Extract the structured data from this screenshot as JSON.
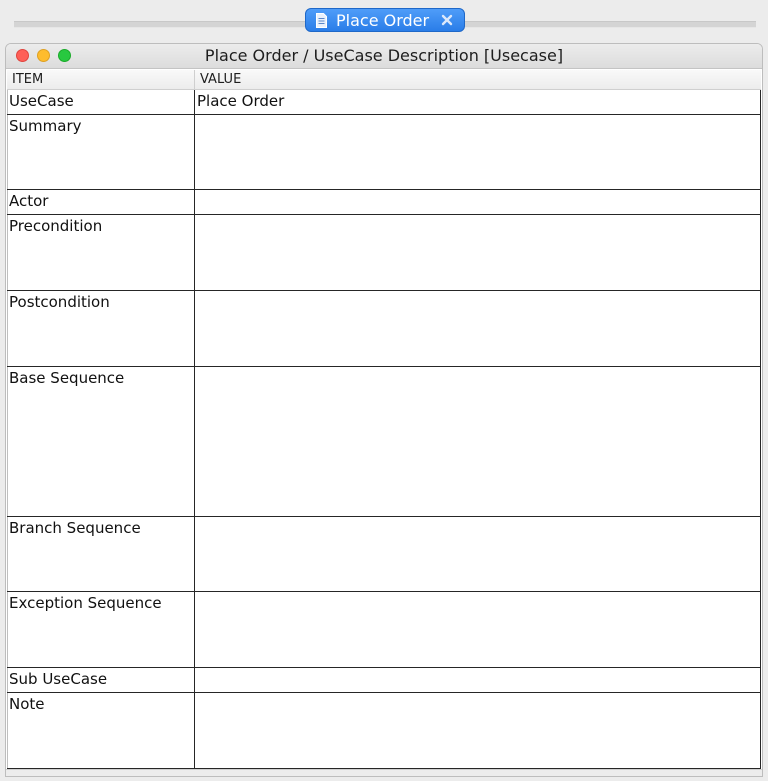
{
  "tab": {
    "title": "Place Order",
    "icon": "document-icon",
    "close_icon": "close-icon",
    "color": "#2a7de8"
  },
  "window": {
    "title": "Place Order / UseCase Description [Usecase]"
  },
  "table": {
    "columns": [
      "ITEM",
      "VALUE"
    ],
    "rows": [
      {
        "item": "UseCase",
        "value": "Place Order"
      },
      {
        "item": "Summary",
        "value": ""
      },
      {
        "item": "Actor",
        "value": ""
      },
      {
        "item": "Precondition",
        "value": ""
      },
      {
        "item": "Postcondition",
        "value": ""
      },
      {
        "item": "Base Sequence",
        "value": ""
      },
      {
        "item": "Branch Sequence",
        "value": ""
      },
      {
        "item": "Exception Sequence",
        "value": ""
      },
      {
        "item": "Sub UseCase",
        "value": ""
      },
      {
        "item": "Note",
        "value": ""
      }
    ]
  }
}
